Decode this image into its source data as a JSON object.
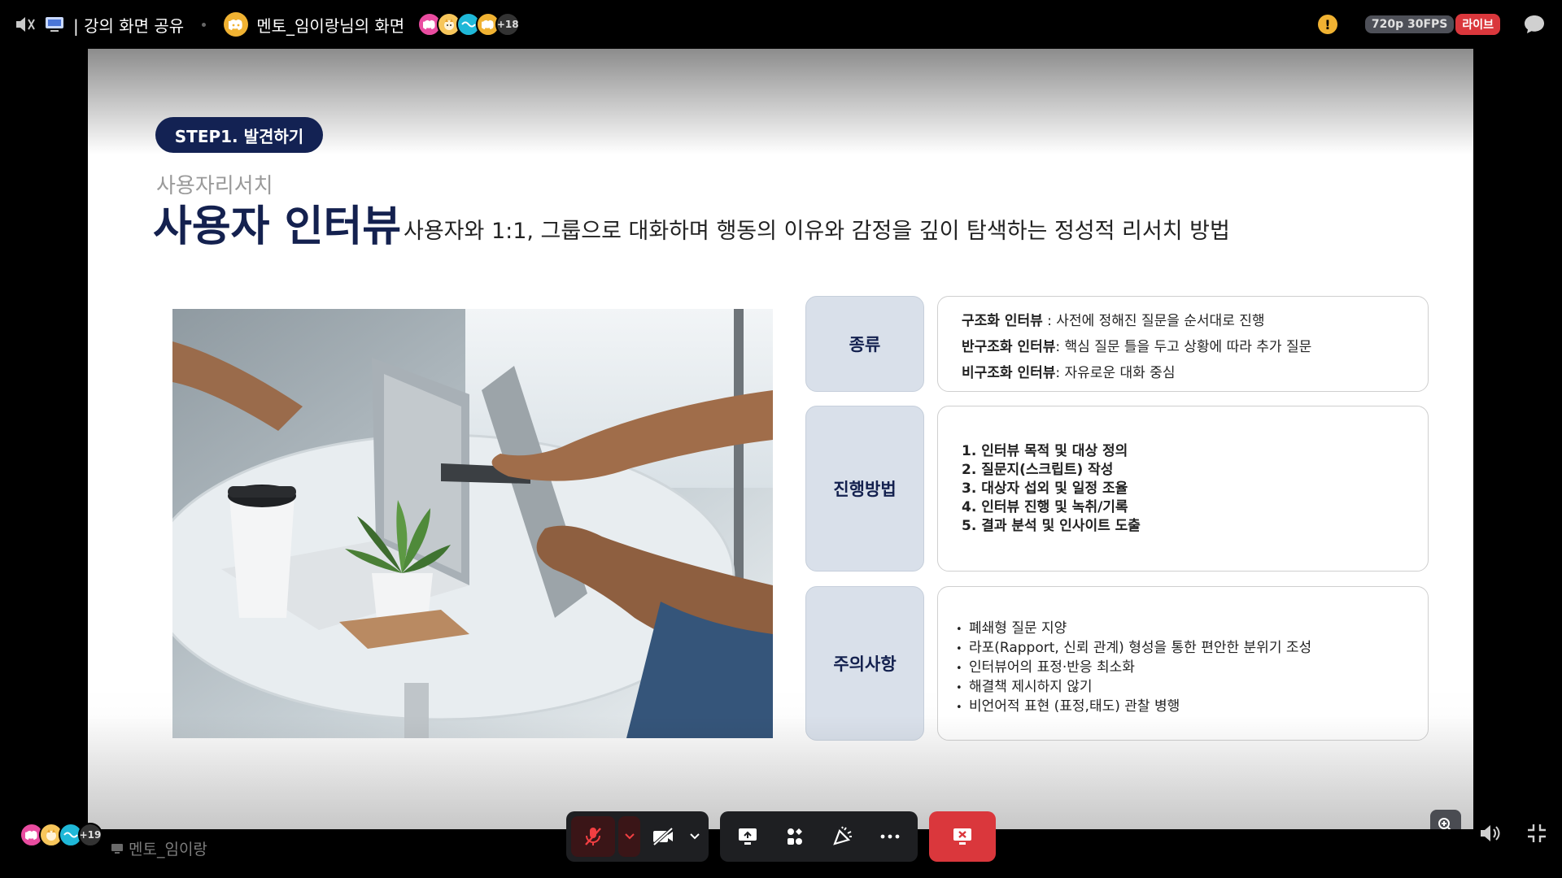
{
  "topbar": {
    "title": "| 강의 화면 공유",
    "stream_title": "멘토_임이랑님의 화면",
    "viewer_more": "+18",
    "quality": "720p 30FPS",
    "live": "라이브",
    "warning": "!"
  },
  "slide": {
    "step": "STEP1. 발견하기",
    "subtitle": "사용자리서치",
    "title": "사용자 인터뷰",
    "description": "사용자와 1:1, 그룹으로 대화하며 행동의 이유와 감정을 깊이 탐색하는 정성적 리서치 방법",
    "rows": [
      {
        "label": "종류",
        "items": [
          {
            "bold": "구조화 인터뷰",
            "text": "   : 사전에 정해진 질문을 순서대로 진행"
          },
          {
            "bold": "반구조화 인터뷰",
            "text": ": 핵심 질문 틀을 두고 상황에 따라 추가 질문"
          },
          {
            "bold": "비구조화 인터뷰",
            "text": ": 자유로운 대화 중심"
          }
        ]
      },
      {
        "label": "진행방법",
        "items": [
          "1. 인터뷰 목적 및 대상 정의",
          "2. 질문지(스크립트) 작성",
          "3. 대상자 섭외 및 일정 조율",
          "4. 인터뷰 진행 및 녹취/기록",
          "5. 결과 분석 및 인사이트 도출"
        ]
      },
      {
        "label": "주의사항",
        "items": [
          "폐쇄형 질문 지양",
          "라포(Rapport, 신뢰 관계) 형성을 통한 편안한 분위기 조성",
          "인터뷰어의 표정·반응 최소화",
          "해결책 제시하지 않기",
          "비언어적 표현 (표정,태도) 관찰 병행"
        ]
      }
    ]
  },
  "bottom": {
    "participants_more": "+19",
    "speaker_name": "멘토_임이랑"
  },
  "colors": {
    "navy": "#14214f",
    "live_red": "#da373c",
    "label_bg": "#d9e0ea",
    "warning_yellow": "#f0b232"
  },
  "icons": [
    "volume-muted-icon",
    "screen-share-icon",
    "discord-icon",
    "warning-icon",
    "chat-icon",
    "chevron-up-icon",
    "people-icon",
    "zoom-in-icon",
    "mic-muted-icon",
    "chevron-down-icon",
    "camera-off-icon",
    "share-screen-icon",
    "activities-icon",
    "soundboard-icon",
    "more-icon",
    "leave-call-icon",
    "volume-icon",
    "exit-fullscreen-icon"
  ]
}
